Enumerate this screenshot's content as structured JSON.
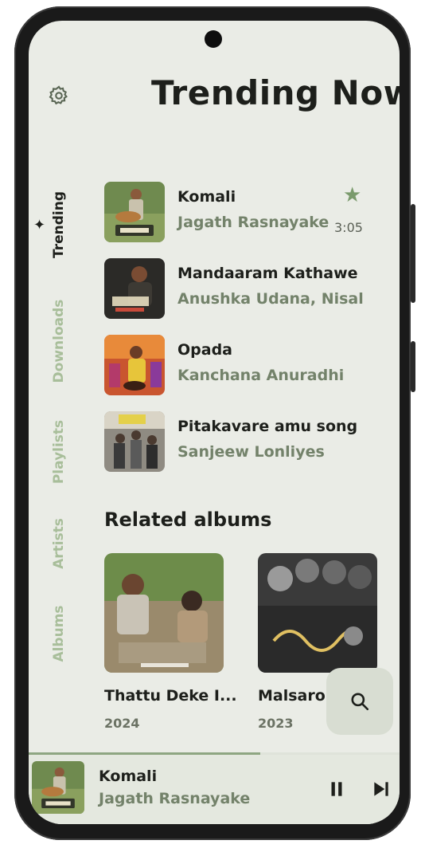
{
  "header": {
    "title": "Trending Now",
    "settings_icon": "gear-icon"
  },
  "side_nav": {
    "items": [
      {
        "label": "Trending",
        "active": true,
        "icon": "sparkle-icon"
      },
      {
        "label": "Downloads",
        "active": false
      },
      {
        "label": "Playlists",
        "active": false
      },
      {
        "label": "Artists",
        "active": false
      },
      {
        "label": "Albums",
        "active": false
      }
    ]
  },
  "tracks": [
    {
      "title": "Komali",
      "artist": "Jagath Rasnayake",
      "duration": "3:05",
      "starred": true
    },
    {
      "title": "Mandaaram Kathawe",
      "artist": "Anushka Udana, Nisal"
    },
    {
      "title": "Opada",
      "artist": "Kanchana Anuradhi"
    },
    {
      "title": "Pitakavare amu song",
      "artist": "Sanjeew Lonliyes"
    }
  ],
  "related": {
    "title": "Related albums",
    "albums": [
      {
        "title": "Thattu Deke I...",
        "year": "2024"
      },
      {
        "title": "Malsaro",
        "year": "2023"
      }
    ]
  },
  "search_fab": {
    "icon": "search-icon"
  },
  "now_playing": {
    "title": "Komali",
    "artist": "Jagath Rasnayake",
    "progress": 0.625,
    "controls": [
      "pause-icon",
      "skip-next-icon"
    ]
  },
  "colors": {
    "background": "#eaece6",
    "accent": "#7a9a6c",
    "text_primary": "#1d1f1b",
    "text_secondary": "#73826a",
    "nav_inactive": "#a8be9a"
  }
}
